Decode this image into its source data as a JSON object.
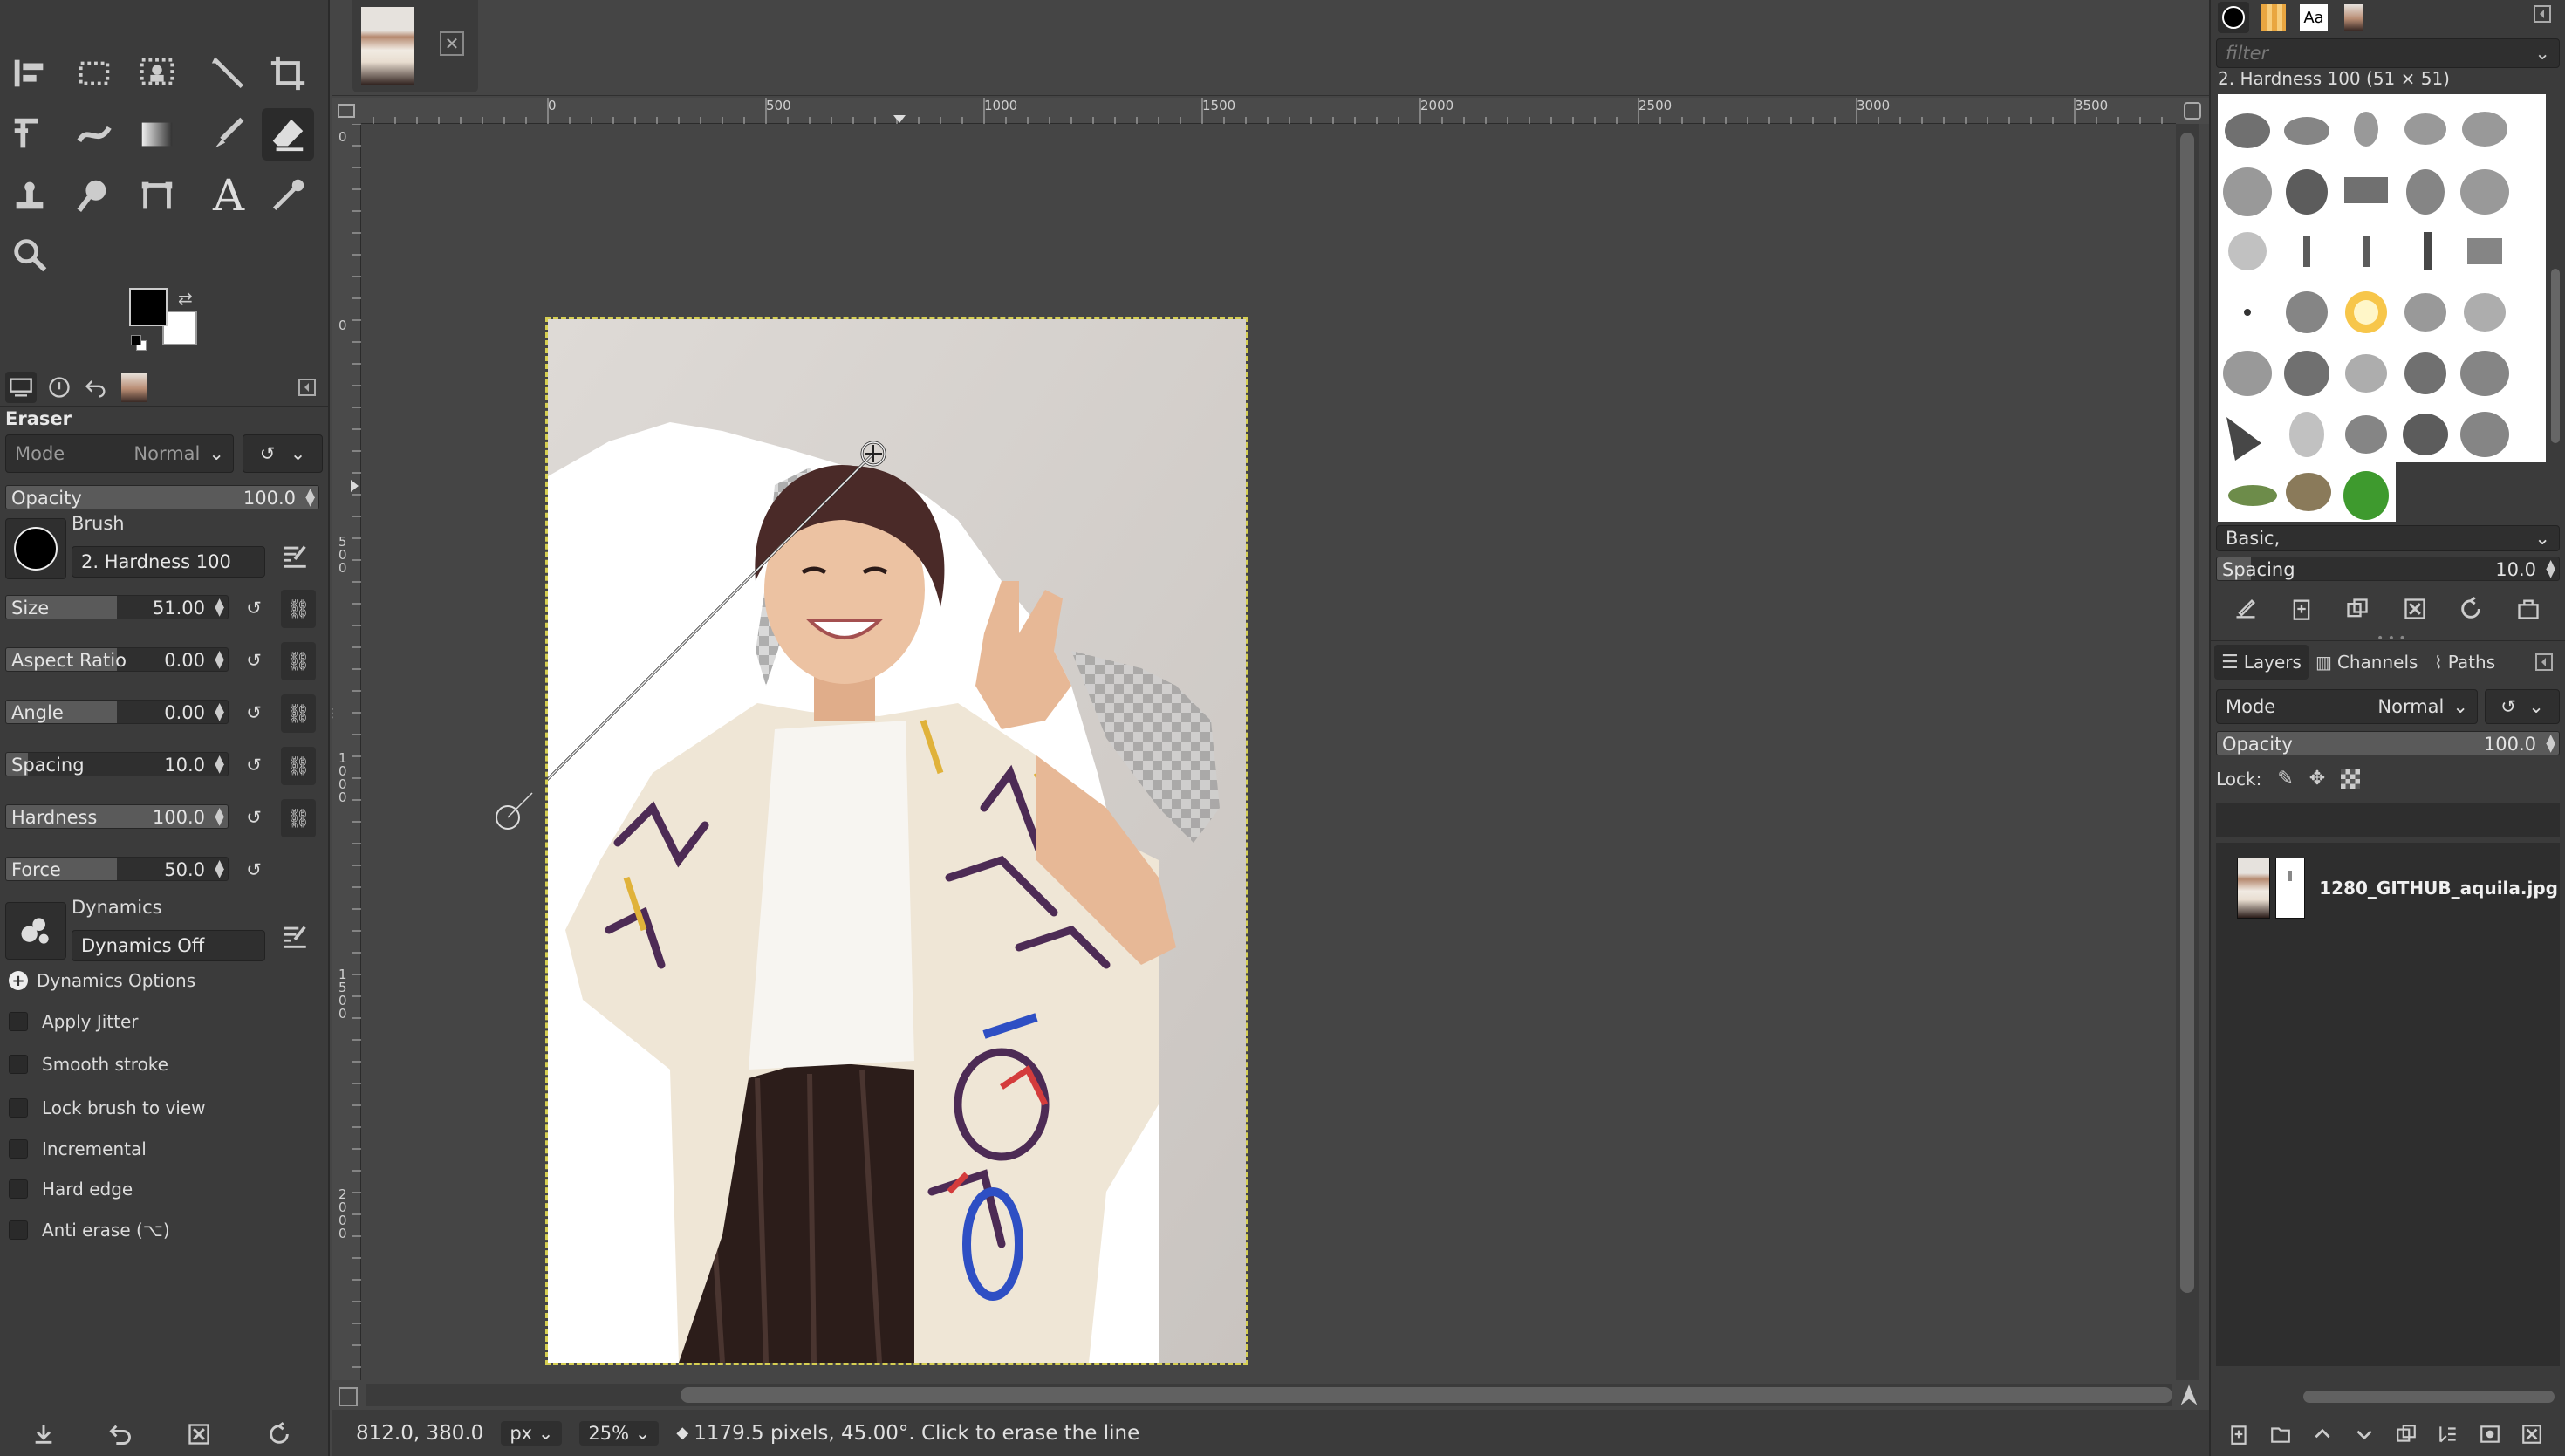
{
  "colors": {
    "accent": "#d6cf52",
    "panel_bg": "#3b3b3b",
    "canvas_bg": "#454545"
  },
  "image_tab": {
    "close_icon": "close-icon"
  },
  "tool_options": {
    "title": "Eraser",
    "mode_label": "Mode",
    "mode_value": "Normal",
    "opacity": {
      "label": "Opacity",
      "value": "100.0",
      "fraction": 1.0
    },
    "brush_label": "Brush",
    "brush_name": "2. Hardness 100",
    "size": {
      "label": "Size",
      "value": "51.00",
      "fraction": 0.5
    },
    "aspect": {
      "label": "Aspect Ratio",
      "value": "0.00",
      "fraction": 0.5
    },
    "angle": {
      "label": "Angle",
      "value": "0.00",
      "fraction": 0.5
    },
    "spacing": {
      "label": "Spacing",
      "value": "10.0",
      "fraction": 0.1
    },
    "hardness": {
      "label": "Hardness",
      "value": "100.0",
      "fraction": 1.0
    },
    "force": {
      "label": "Force",
      "value": "50.0",
      "fraction": 0.5
    },
    "dynamics_label": "Dynamics",
    "dynamics_value": "Dynamics Off",
    "dynamics_options": "Dynamics Options",
    "checks": [
      "Apply Jitter",
      "Smooth stroke",
      "Lock brush to view",
      "Incremental",
      "Hard edge",
      "Anti erase  (⌥)"
    ]
  },
  "ruler": {
    "h_ticks": [
      "0",
      "500",
      "1000",
      "1500",
      "2000",
      "2500",
      "3000",
      "3500"
    ],
    "v_ticks": [
      "0",
      "5\n0\n0",
      "1\n0\n0\n0",
      "1\n5\n0\n0",
      "2\n0\n0\n0"
    ]
  },
  "status": {
    "coords": "812.0, 380.0",
    "unit": "px",
    "zoom": "25%",
    "message": "1179.5 pixels, 45.00°. Click to erase the line"
  },
  "brushes": {
    "filter_placeholder": "filter",
    "selected": "2. Hardness 100 (51 × 51)",
    "preset": "Basic,",
    "spacing_label": "Spacing",
    "spacing_value": "10.0"
  },
  "layers": {
    "tabs": [
      "Layers",
      "Channels",
      "Paths"
    ],
    "mode_label": "Mode",
    "mode_value": "Normal",
    "opacity_label": "Opacity",
    "opacity_value": "100.0",
    "lock_label": "Lock:",
    "layer_name": "1280_GITHUB_aquila.jpg"
  }
}
